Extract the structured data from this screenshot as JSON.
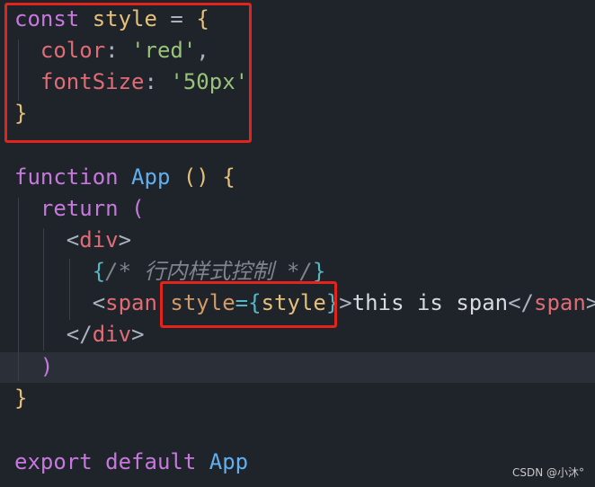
{
  "code": {
    "l1": {
      "kw": "const",
      "var": "style",
      "op": "=",
      "brace": "{"
    },
    "l2": {
      "prop": "color",
      "colon": ":",
      "str": "'red'",
      "comma": ","
    },
    "l3": {
      "prop": "fontSize",
      "colon": ":",
      "str": "'50px'"
    },
    "l4": {
      "brace": "}"
    },
    "l6": {
      "kw": "function",
      "fn": "App",
      "paren": "()",
      "brace": "{"
    },
    "l7": {
      "kw": "return",
      "paren": "("
    },
    "l8": {
      "open": "<",
      "tag": "div",
      "close": ">"
    },
    "l9": {
      "open": "{",
      "comment": "/* 行内样式控制 */",
      "close": "}"
    },
    "l10": {
      "open": "<",
      "tag": "span",
      "attr": "style",
      "eq": "=",
      "jsx_open": "{",
      "expr": "style",
      "jsx_close": "}",
      "gt": ">",
      "text": "this is span",
      "close_open": "</",
      "close_tag": "span",
      "close_gt": ">"
    },
    "l11": {
      "open": "</",
      "tag": "div",
      "close": ">"
    },
    "l12": {
      "paren": ")"
    },
    "l13": {
      "brace": "}"
    },
    "l15": {
      "kw1": "export",
      "kw2": "default",
      "fn": "App"
    }
  },
  "watermark": "CSDN @小沐°",
  "colors": {
    "background": "#1f232a",
    "highlight_box": "#e3241c"
  }
}
